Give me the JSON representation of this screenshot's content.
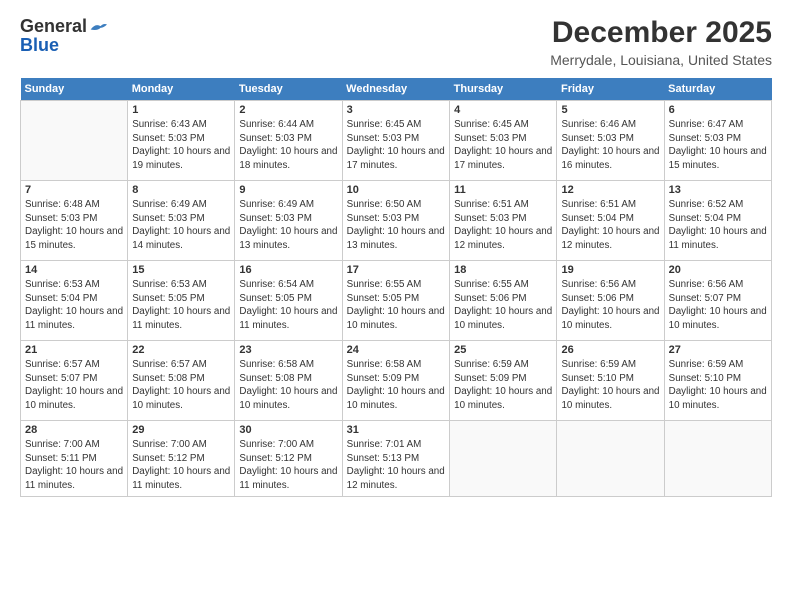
{
  "logo": {
    "general": "General",
    "blue": "Blue"
  },
  "title": "December 2025",
  "subtitle": "Merrydale, Louisiana, United States",
  "headers": [
    "Sunday",
    "Monday",
    "Tuesday",
    "Wednesday",
    "Thursday",
    "Friday",
    "Saturday"
  ],
  "weeks": [
    [
      {
        "day": "",
        "sunrise": "",
        "sunset": "",
        "daylight": ""
      },
      {
        "day": "1",
        "sunrise": "Sunrise: 6:43 AM",
        "sunset": "Sunset: 5:03 PM",
        "daylight": "Daylight: 10 hours and 19 minutes."
      },
      {
        "day": "2",
        "sunrise": "Sunrise: 6:44 AM",
        "sunset": "Sunset: 5:03 PM",
        "daylight": "Daylight: 10 hours and 18 minutes."
      },
      {
        "day": "3",
        "sunrise": "Sunrise: 6:45 AM",
        "sunset": "Sunset: 5:03 PM",
        "daylight": "Daylight: 10 hours and 17 minutes."
      },
      {
        "day": "4",
        "sunrise": "Sunrise: 6:45 AM",
        "sunset": "Sunset: 5:03 PM",
        "daylight": "Daylight: 10 hours and 17 minutes."
      },
      {
        "day": "5",
        "sunrise": "Sunrise: 6:46 AM",
        "sunset": "Sunset: 5:03 PM",
        "daylight": "Daylight: 10 hours and 16 minutes."
      },
      {
        "day": "6",
        "sunrise": "Sunrise: 6:47 AM",
        "sunset": "Sunset: 5:03 PM",
        "daylight": "Daylight: 10 hours and 15 minutes."
      }
    ],
    [
      {
        "day": "7",
        "sunrise": "Sunrise: 6:48 AM",
        "sunset": "Sunset: 5:03 PM",
        "daylight": "Daylight: 10 hours and 15 minutes."
      },
      {
        "day": "8",
        "sunrise": "Sunrise: 6:49 AM",
        "sunset": "Sunset: 5:03 PM",
        "daylight": "Daylight: 10 hours and 14 minutes."
      },
      {
        "day": "9",
        "sunrise": "Sunrise: 6:49 AM",
        "sunset": "Sunset: 5:03 PM",
        "daylight": "Daylight: 10 hours and 13 minutes."
      },
      {
        "day": "10",
        "sunrise": "Sunrise: 6:50 AM",
        "sunset": "Sunset: 5:03 PM",
        "daylight": "Daylight: 10 hours and 13 minutes."
      },
      {
        "day": "11",
        "sunrise": "Sunrise: 6:51 AM",
        "sunset": "Sunset: 5:03 PM",
        "daylight": "Daylight: 10 hours and 12 minutes."
      },
      {
        "day": "12",
        "sunrise": "Sunrise: 6:51 AM",
        "sunset": "Sunset: 5:04 PM",
        "daylight": "Daylight: 10 hours and 12 minutes."
      },
      {
        "day": "13",
        "sunrise": "Sunrise: 6:52 AM",
        "sunset": "Sunset: 5:04 PM",
        "daylight": "Daylight: 10 hours and 11 minutes."
      }
    ],
    [
      {
        "day": "14",
        "sunrise": "Sunrise: 6:53 AM",
        "sunset": "Sunset: 5:04 PM",
        "daylight": "Daylight: 10 hours and 11 minutes."
      },
      {
        "day": "15",
        "sunrise": "Sunrise: 6:53 AM",
        "sunset": "Sunset: 5:05 PM",
        "daylight": "Daylight: 10 hours and 11 minutes."
      },
      {
        "day": "16",
        "sunrise": "Sunrise: 6:54 AM",
        "sunset": "Sunset: 5:05 PM",
        "daylight": "Daylight: 10 hours and 11 minutes."
      },
      {
        "day": "17",
        "sunrise": "Sunrise: 6:55 AM",
        "sunset": "Sunset: 5:05 PM",
        "daylight": "Daylight: 10 hours and 10 minutes."
      },
      {
        "day": "18",
        "sunrise": "Sunrise: 6:55 AM",
        "sunset": "Sunset: 5:06 PM",
        "daylight": "Daylight: 10 hours and 10 minutes."
      },
      {
        "day": "19",
        "sunrise": "Sunrise: 6:56 AM",
        "sunset": "Sunset: 5:06 PM",
        "daylight": "Daylight: 10 hours and 10 minutes."
      },
      {
        "day": "20",
        "sunrise": "Sunrise: 6:56 AM",
        "sunset": "Sunset: 5:07 PM",
        "daylight": "Daylight: 10 hours and 10 minutes."
      }
    ],
    [
      {
        "day": "21",
        "sunrise": "Sunrise: 6:57 AM",
        "sunset": "Sunset: 5:07 PM",
        "daylight": "Daylight: 10 hours and 10 minutes."
      },
      {
        "day": "22",
        "sunrise": "Sunrise: 6:57 AM",
        "sunset": "Sunset: 5:08 PM",
        "daylight": "Daylight: 10 hours and 10 minutes."
      },
      {
        "day": "23",
        "sunrise": "Sunrise: 6:58 AM",
        "sunset": "Sunset: 5:08 PM",
        "daylight": "Daylight: 10 hours and 10 minutes."
      },
      {
        "day": "24",
        "sunrise": "Sunrise: 6:58 AM",
        "sunset": "Sunset: 5:09 PM",
        "daylight": "Daylight: 10 hours and 10 minutes."
      },
      {
        "day": "25",
        "sunrise": "Sunrise: 6:59 AM",
        "sunset": "Sunset: 5:09 PM",
        "daylight": "Daylight: 10 hours and 10 minutes."
      },
      {
        "day": "26",
        "sunrise": "Sunrise: 6:59 AM",
        "sunset": "Sunset: 5:10 PM",
        "daylight": "Daylight: 10 hours and 10 minutes."
      },
      {
        "day": "27",
        "sunrise": "Sunrise: 6:59 AM",
        "sunset": "Sunset: 5:10 PM",
        "daylight": "Daylight: 10 hours and 10 minutes."
      }
    ],
    [
      {
        "day": "28",
        "sunrise": "Sunrise: 7:00 AM",
        "sunset": "Sunset: 5:11 PM",
        "daylight": "Daylight: 10 hours and 11 minutes."
      },
      {
        "day": "29",
        "sunrise": "Sunrise: 7:00 AM",
        "sunset": "Sunset: 5:12 PM",
        "daylight": "Daylight: 10 hours and 11 minutes."
      },
      {
        "day": "30",
        "sunrise": "Sunrise: 7:00 AM",
        "sunset": "Sunset: 5:12 PM",
        "daylight": "Daylight: 10 hours and 11 minutes."
      },
      {
        "day": "31",
        "sunrise": "Sunrise: 7:01 AM",
        "sunset": "Sunset: 5:13 PM",
        "daylight": "Daylight: 10 hours and 12 minutes."
      },
      {
        "day": "",
        "sunrise": "",
        "sunset": "",
        "daylight": ""
      },
      {
        "day": "",
        "sunrise": "",
        "sunset": "",
        "daylight": ""
      },
      {
        "day": "",
        "sunrise": "",
        "sunset": "",
        "daylight": ""
      }
    ]
  ]
}
